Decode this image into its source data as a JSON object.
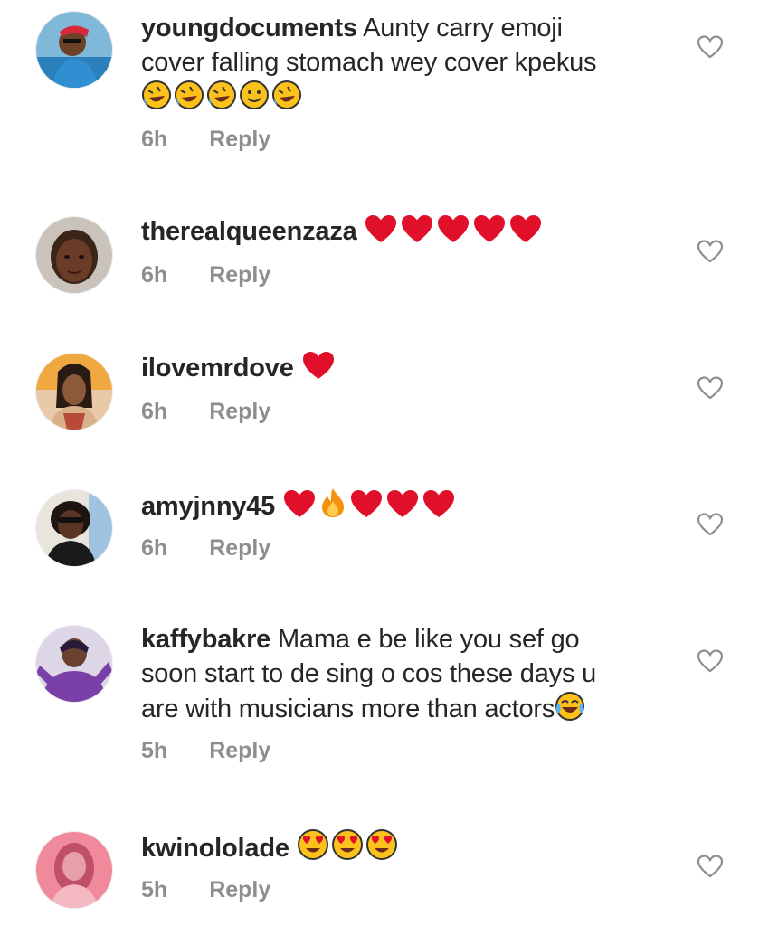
{
  "comments": [
    {
      "username": "youngdocuments",
      "text_lines": [
        "Aunty carry emoji",
        "cover falling stomach wey cover kpekus"
      ],
      "emojis": [
        "rofl",
        "rofl",
        "rofl",
        "slight-smile",
        "rofl"
      ],
      "time": "6h",
      "reply": "Reply"
    },
    {
      "username": "therealqueenzaza",
      "text_lines": [],
      "emojis": [
        "heart",
        "heart",
        "heart",
        "heart",
        "heart"
      ],
      "time": "6h",
      "reply": "Reply"
    },
    {
      "username": "ilovemrdove",
      "text_lines": [],
      "emojis": [
        "heart"
      ],
      "time": "6h",
      "reply": "Reply"
    },
    {
      "username": "amyjnny45",
      "text_lines": [],
      "emojis": [
        "heart",
        "fire",
        "heart",
        "heart",
        "heart"
      ],
      "time": "6h",
      "reply": "Reply"
    },
    {
      "username": "kaffybakre",
      "text_lines": [
        "Mama e be like you sef go",
        "soon start to de sing o cos these days u",
        "are with musicians more than actors"
      ],
      "emojis": [
        "joy"
      ],
      "time": "5h",
      "reply": "Reply"
    },
    {
      "username": "kwinololade",
      "text_lines": [],
      "emojis": [
        "heart-eyes",
        "heart-eyes",
        "heart-eyes"
      ],
      "time": "5h",
      "reply": "Reply"
    }
  ],
  "colors": {
    "username": "#262626",
    "meta": "#8e8e8e",
    "heart": "#e0102a",
    "like_outline": "#8e8e8e"
  }
}
